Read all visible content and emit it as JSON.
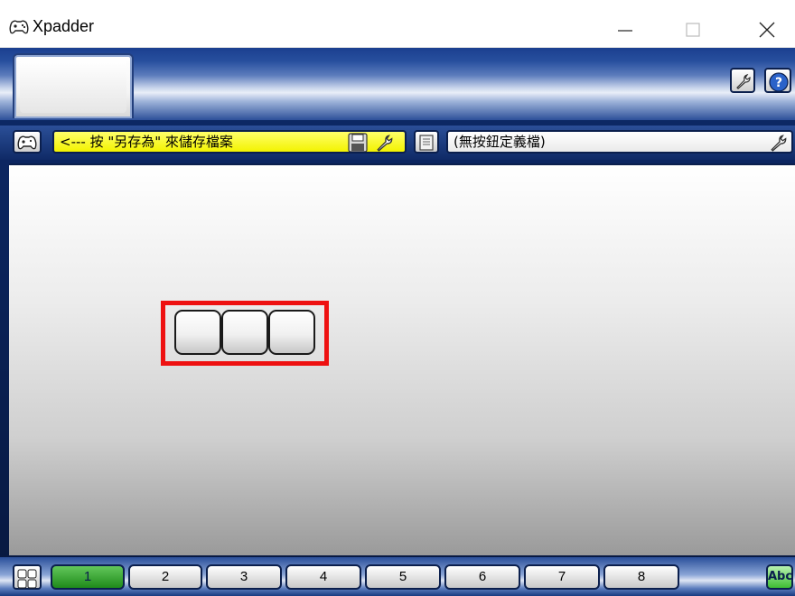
{
  "window": {
    "title": "Xpadder",
    "icon": "gamepad-icon",
    "controls": [
      "minimize-icon",
      "maximize-icon",
      "close-icon"
    ]
  },
  "header": {
    "settings_icon": "wrench-icon",
    "help_icon": "help-icon"
  },
  "profile": {
    "controller_icon": "gamepad-icon",
    "controller_name": "<--- 按 \"另存為\" 來儲存檔案",
    "save_icon": "floppy-disk-icon",
    "controller_settings_icon": "wrench-icon",
    "layout_icon": "document-icon",
    "layout_name": "(無按鈕定義檔)",
    "layout_settings_icon": "wrench-icon"
  },
  "canvas": {
    "key_buttons": [
      "",
      "",
      ""
    ]
  },
  "sets": {
    "selector_icon": "grid-icon",
    "items": [
      "1",
      "2",
      "3",
      "4",
      "5",
      "6",
      "7",
      "8"
    ],
    "active": "1",
    "abc_label": "Abc"
  },
  "colors": {
    "accent_blue": "#1b3f8f",
    "yellow_field": "#f3f300",
    "highlight_red": "#ee1111",
    "active_green": "#1f8a1a"
  }
}
